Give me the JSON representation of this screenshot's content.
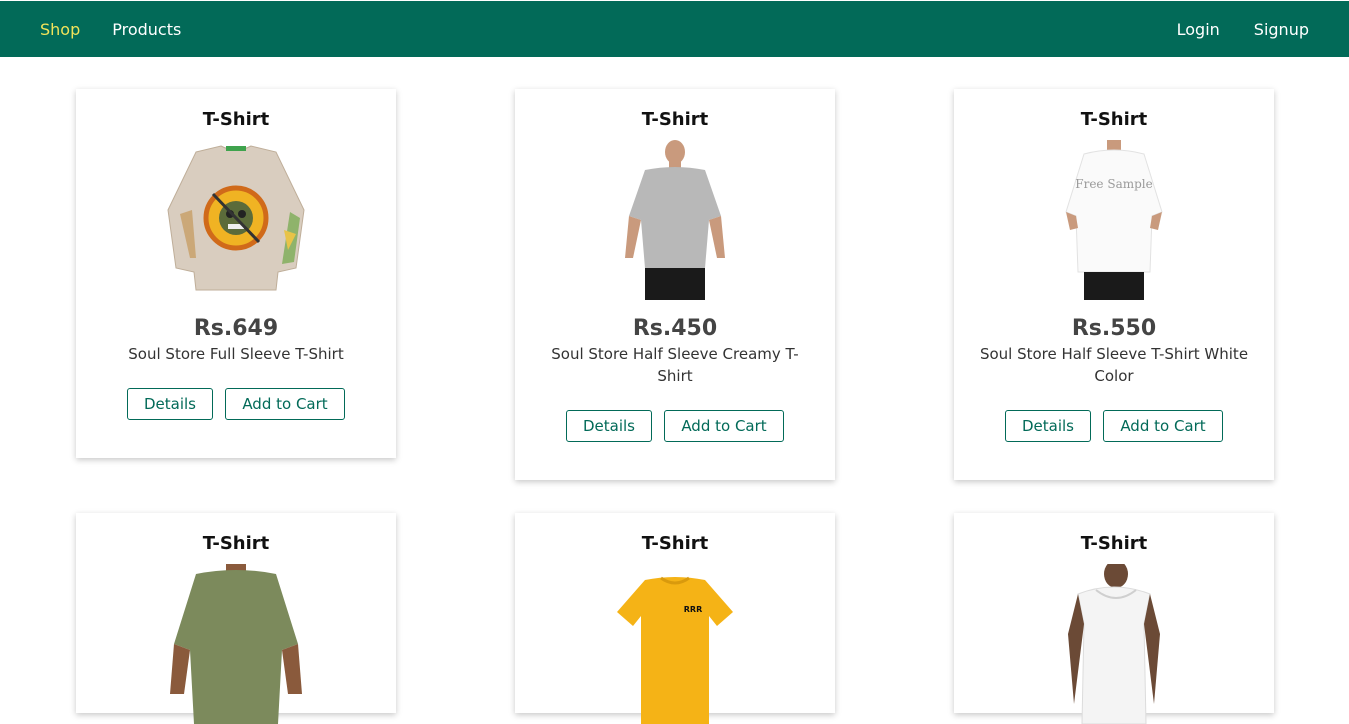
{
  "nav": {
    "left": [
      {
        "label": "Shop",
        "active": true
      },
      {
        "label": "Products",
        "active": false
      }
    ],
    "right": [
      {
        "label": "Login"
      },
      {
        "label": "Signup"
      }
    ],
    "background": "#026a58",
    "active_color": "#f1e35a"
  },
  "products": [
    {
      "category": "T-Shirt",
      "price": "Rs.649",
      "name": "Soul Store Full Sleeve T-Shirt",
      "details_label": "Details",
      "cart_label": "Add to Cart",
      "image": "beige-graphic-sweatshirt"
    },
    {
      "category": "T-Shirt",
      "price": "Rs.450",
      "name": "Soul Store Half Sleeve Creamy T-Shirt",
      "details_label": "Details",
      "cart_label": "Add to Cart",
      "image": "grey-tshirt-model"
    },
    {
      "category": "T-Shirt",
      "price": "Rs.550",
      "name": "Soul Store Half Sleeve T-Shirt White Color",
      "details_label": "Details",
      "cart_label": "Add to Cart",
      "image": "white-tshirt-model",
      "image_text": "Free Sample"
    },
    {
      "category": "T-Shirt",
      "image": "olive-tshirt-model"
    },
    {
      "category": "T-Shirt",
      "image": "yellow-tshirt",
      "image_text": "RRR"
    },
    {
      "category": "T-Shirt",
      "image": "white-sleeveless-hoodie-model"
    }
  ]
}
